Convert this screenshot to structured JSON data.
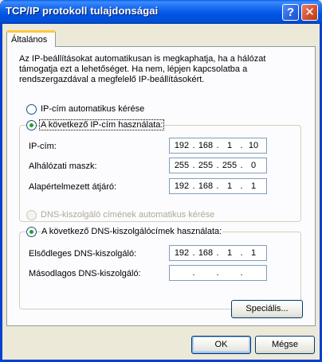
{
  "window": {
    "title": "TCP/IP protokoll tulajdonságai",
    "help_glyph": "?",
    "close_glyph": "✕"
  },
  "tabs": [
    {
      "label": "Általános"
    }
  ],
  "description": "Az IP-beállításokat automatikusan is megkaphatja, ha a hálózat támogatja ezt a lehetőséget. Ha nem, lépjen kapcsolatba a rendszergazdával a megfelelő IP-beállításokért.",
  "ip_mode": {
    "auto_label": "IP-cím automatikus kérése",
    "manual_label": "A következő IP-cím használata:",
    "selected": "manual"
  },
  "ip_fields": {
    "ip_label": "IP-cím:",
    "ip_value": [
      "192",
      "168",
      "1",
      "10"
    ],
    "mask_label": "Alhálózati maszk:",
    "mask_value": [
      "255",
      "255",
      "255",
      "0"
    ],
    "gateway_label": "Alapértelmezett átjáró:",
    "gateway_value": [
      "192",
      "168",
      "1",
      "1"
    ]
  },
  "dns_mode": {
    "auto_label": "DNS-kiszolgáló címének automatikus kérése",
    "manual_label": "A következő DNS-kiszolgálócímek használata:",
    "selected": "manual"
  },
  "dns_fields": {
    "primary_label": "Elsődleges DNS-kiszolgáló:",
    "primary_value": [
      "192",
      "168",
      "1",
      "1"
    ],
    "secondary_label": "Másodlagos DNS-kiszolgáló:",
    "secondary_value": [
      "",
      "",
      "",
      ""
    ]
  },
  "buttons": {
    "advanced": "Speciális...",
    "ok": "OK",
    "cancel": "Mégse"
  }
}
